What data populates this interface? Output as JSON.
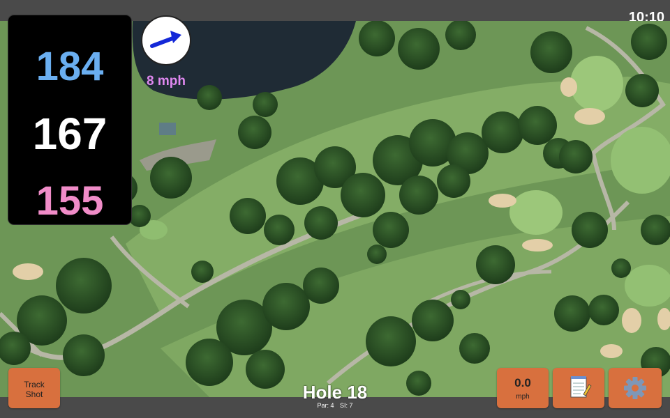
{
  "status": {
    "time": "10:10"
  },
  "distances": {
    "back": "184",
    "middle": "167",
    "front": "155"
  },
  "wind": {
    "speed_label": "8 mph",
    "icon": "wind-arrow-icon",
    "color": "#e088f0"
  },
  "hole": {
    "title": "Hole 18",
    "par": "Par: 4",
    "si": "SI: 7"
  },
  "buttons": {
    "track_shot": [
      "Track",
      "Shot"
    ],
    "speed_value": "0.0",
    "speed_unit": "mph",
    "notes_icon": "notepad-icon",
    "settings_icon": "gear-icon"
  },
  "colors": {
    "back": "#6aaef0",
    "middle": "#ffffff",
    "front": "#f08cc8",
    "button": "#d8703e",
    "bar": "#4a4a4a"
  }
}
